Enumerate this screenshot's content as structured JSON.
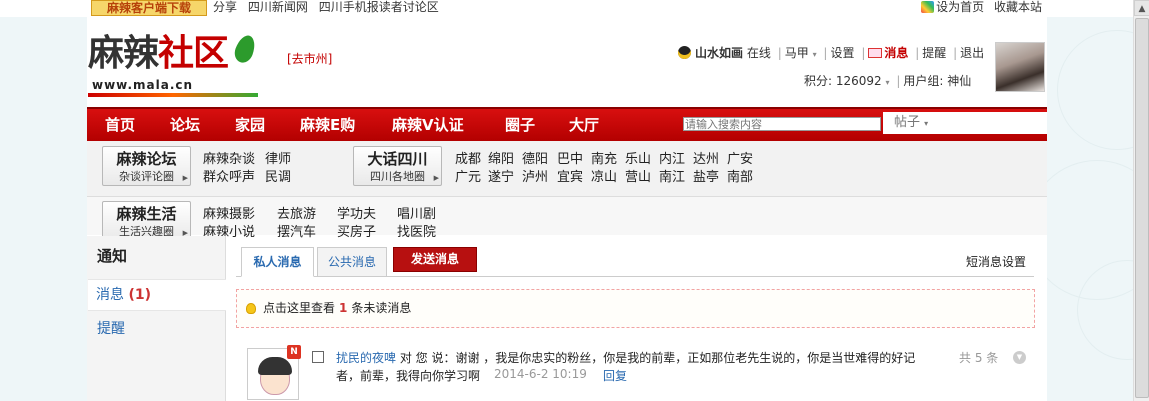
{
  "topbar": {
    "download_label": "麻辣客户端下载",
    "links": [
      "分享",
      "四川新闻网",
      "四川手机报读者讨论区"
    ],
    "right_links": [
      "设为首页",
      "收藏本站"
    ]
  },
  "logo": {
    "text_a": "麻辣",
    "text_b": "社区",
    "url": "www.mala.cn"
  },
  "city_tag": "[去市州]",
  "user": {
    "name": "山水如画",
    "status": "在线",
    "horse": "马甲",
    "settings": "设置",
    "messages": "消息",
    "remind": "提醒",
    "logout": "退出",
    "points_label": "积分: 126092",
    "group_label": "用户组: 神仙"
  },
  "nav": {
    "items": [
      "首页",
      "论坛",
      "家园",
      "麻辣E购",
      "麻辣V认证",
      "圈子",
      "大厅"
    ],
    "search_placeholder": "请输入搜索内容",
    "search_type": "帖子"
  },
  "boards": {
    "forum": {
      "title": "麻辣论坛",
      "sub": "杂谈评论圈"
    },
    "forum_links": [
      "麻辣杂谈",
      "律师",
      "群众呼声",
      "民调"
    ],
    "sichuan": {
      "title": "大话四川",
      "sub": "四川各地圈"
    },
    "sichuan_links_1": [
      "成都",
      "绵阳",
      "德阳",
      "巴中",
      "南充",
      "乐山",
      "内江",
      "达州",
      "广安"
    ],
    "sichuan_links_2": [
      "广元",
      "遂宁",
      "泸州",
      "宜宾",
      "凉山",
      "营山",
      "南江",
      "盐亭",
      "南部"
    ],
    "life": {
      "title": "麻辣生活",
      "sub": "生活兴趣圈"
    },
    "life_links_1": [
      "麻辣摄影",
      "去旅游",
      "学功夫",
      "唱川剧"
    ],
    "life_links_2": [
      "麻辣小说",
      "摆汽车",
      "买房子",
      "找医院"
    ]
  },
  "sidebar": {
    "title": "通知",
    "messages_label": "消息",
    "messages_count": "(1)",
    "remind_label": "提醒"
  },
  "tabs": {
    "private": "私人消息",
    "public": "公共消息",
    "send": "发送消息",
    "settings": "短消息设置"
  },
  "notice": {
    "prefix": "点击这里查看",
    "count": "1",
    "suffix": "条未读消息"
  },
  "message": {
    "from": "扰民的夜啤",
    "to_you": "对 您 说：",
    "line1": "谢谢 ，我是你忠实的粉丝，你是我的前辈，正如那位老先生说的，你是当世难得的好记",
    "line2": "者，前辈，我得向你学习啊",
    "time": "2014-6-2 10:19",
    "reply": "回复",
    "total": "共 5 条",
    "badge": "N"
  }
}
